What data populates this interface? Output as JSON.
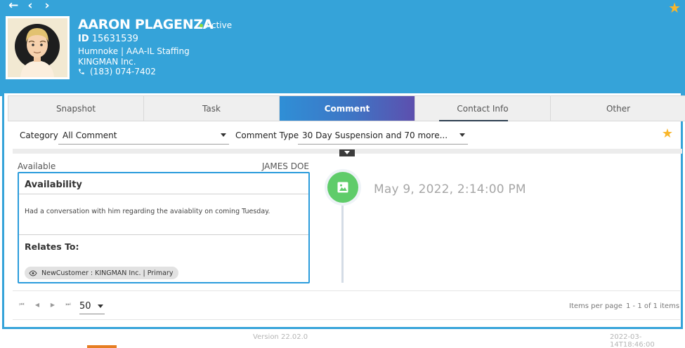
{
  "nav": {
    "back_glyph": "←",
    "collapse_glyph": "‹",
    "forward_glyph": "›"
  },
  "header": {
    "name": "AARON PLAGENZA",
    "status": "Active",
    "id_label": "ID",
    "id_value": "15631539",
    "line1": "Humnoke | AAA-IL Staffing",
    "line2": "KINGMAN Inc.",
    "phone": "(183) 074-7402",
    "favorite_icon": "star-icon",
    "accent_color": "#35a3d9",
    "star_color": "#f9b62a"
  },
  "tabs": [
    {
      "label": "Snapshot"
    },
    {
      "label": "Task"
    },
    {
      "label": "Comment"
    },
    {
      "label": "Contact Info"
    },
    {
      "label": "Other"
    }
  ],
  "filters": {
    "category_label": "Category",
    "category_value": "All Comment",
    "comment_type_label": "Comment Type",
    "comment_type_value": "30 Day Suspension and 70 more..."
  },
  "comment": {
    "status": "Available",
    "author": "JAMES DOE",
    "title": "Availability",
    "body": "Had a conversation with him regarding the avaiablity on coming Tuesday.",
    "relates_label": "Relates To:",
    "relates_chip": "NewCustomer : KINGMAN Inc. | Primary",
    "date": "May 9, 2022, 2:14:00 PM"
  },
  "pager": {
    "page_size": "50",
    "items_per_page_label": "Items per page",
    "count": "1 - 1 of 1 items"
  },
  "footer": {
    "version": "Version 22.02.0",
    "timestamp": "2022-03-14T18:46:00"
  }
}
